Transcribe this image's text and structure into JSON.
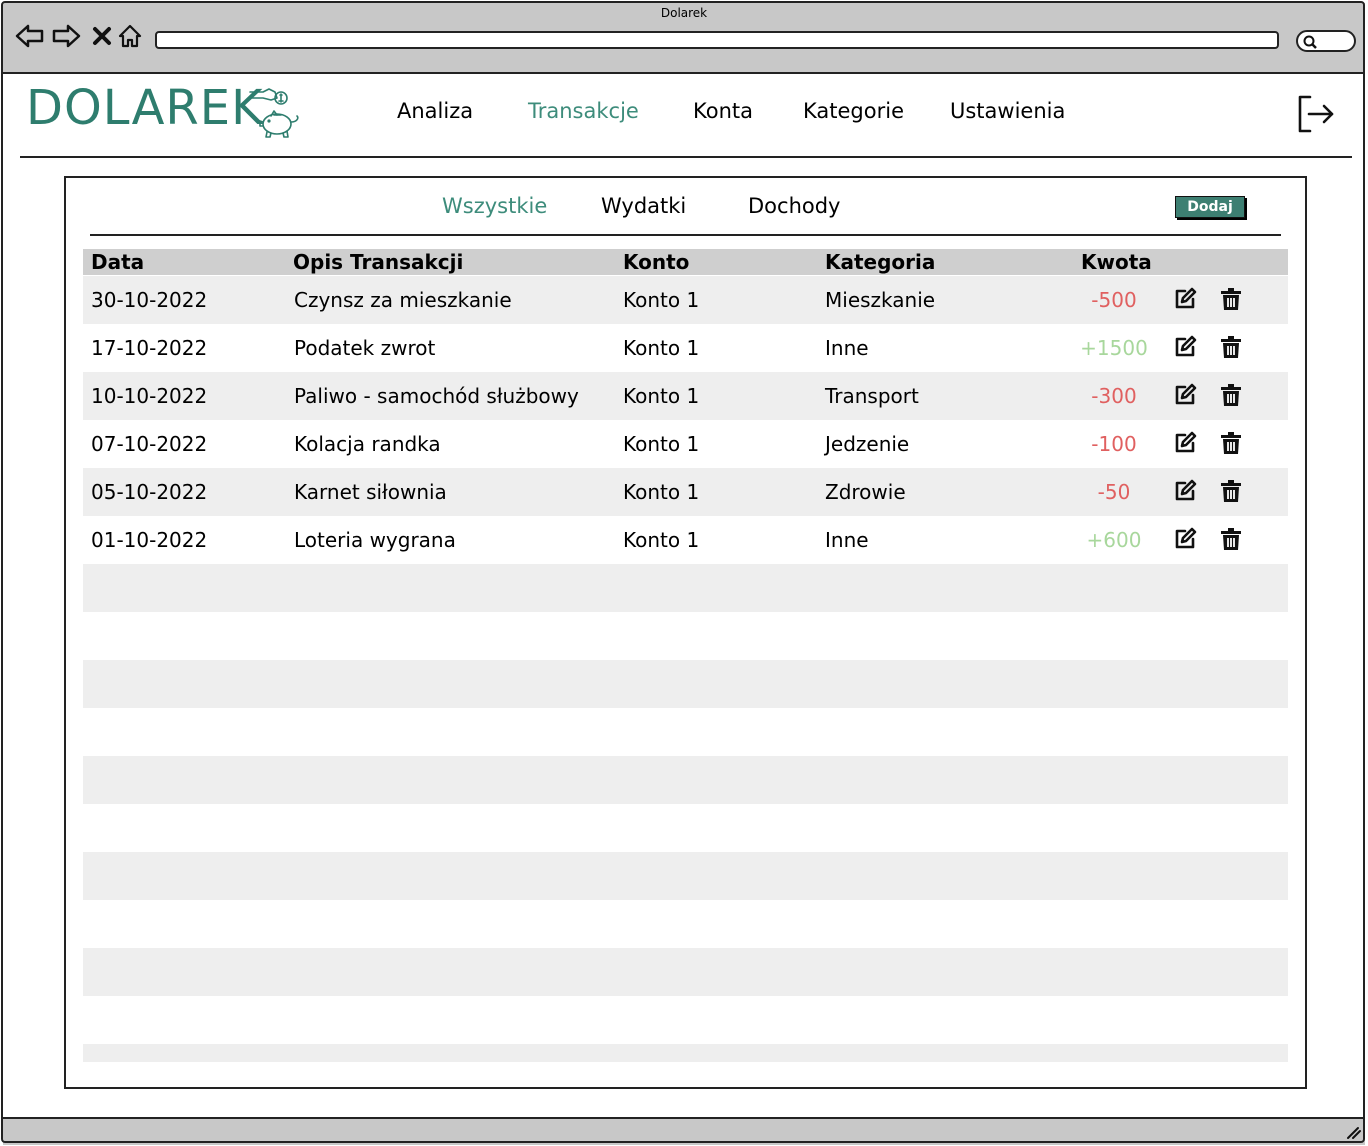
{
  "window": {
    "title": "Dolarek"
  },
  "header": {
    "logo_text": "DOLAREK",
    "nav": [
      {
        "label": "Analiza",
        "active": false
      },
      {
        "label": "Transakcje",
        "active": true
      },
      {
        "label": "Konta",
        "active": false
      },
      {
        "label": "Kategorie",
        "active": false
      },
      {
        "label": "Ustawienia",
        "active": false
      }
    ]
  },
  "filters": {
    "tabs": [
      {
        "label": "Wszystkie",
        "active": true
      },
      {
        "label": "Wydatki",
        "active": false
      },
      {
        "label": "Dochody",
        "active": false
      }
    ],
    "add_label": "Dodaj"
  },
  "table": {
    "columns": [
      "Data",
      "Opis Transakcji",
      "Konto",
      "Kategoria",
      "Kwota"
    ],
    "rows": [
      {
        "date": "30-10-2022",
        "desc": "Czynsz za mieszkanie",
        "account": "Konto 1",
        "category": "Mieszkanie",
        "amount": "-500"
      },
      {
        "date": "17-10-2022",
        "desc": "Podatek zwrot",
        "account": "Konto 1",
        "category": "Inne",
        "amount": "+1500"
      },
      {
        "date": "10-10-2022",
        "desc": "Paliwo - samochód służbowy",
        "account": "Konto 1",
        "category": "Transport",
        "amount": "-300"
      },
      {
        "date": "07-10-2022",
        "desc": "Kolacja randka",
        "account": "Konto 1",
        "category": "Jedzenie",
        "amount": "-100"
      },
      {
        "date": "05-10-2022",
        "desc": "Karnet siłownia",
        "account": "Konto 1",
        "category": "Zdrowie",
        "amount": "-50"
      },
      {
        "date": "01-10-2022",
        "desc": "Loteria wygrana",
        "account": "Konto 1",
        "category": "Inne",
        "amount": "+600"
      }
    ]
  },
  "colors": {
    "accent": "#3d8c7b",
    "negative": "#e06060",
    "positive": "#a8d79c",
    "chrome": "#c8c8c8"
  },
  "icons": [
    "back-icon",
    "forward-icon",
    "close-icon",
    "home-icon",
    "search-icon",
    "logout-icon",
    "edit-icon",
    "trash-icon",
    "resize-grip-icon"
  ]
}
